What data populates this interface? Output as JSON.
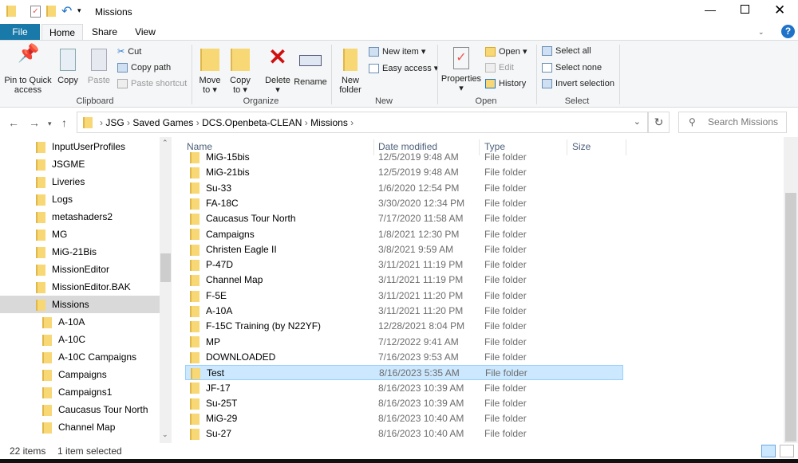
{
  "window": {
    "title": "Missions"
  },
  "tabs": [
    "File",
    "Home",
    "Share",
    "View"
  ],
  "ribbon": {
    "clipboard": {
      "label": "Clipboard",
      "pin": "Pin to Quick access",
      "copy": "Copy",
      "paste": "Paste",
      "cut": "Cut",
      "copy_path": "Copy path",
      "paste_shortcut": "Paste shortcut"
    },
    "organize": {
      "label": "Organize",
      "move_to": "Move to",
      "copy_to": "Copy to",
      "delete": "Delete",
      "rename": "Rename"
    },
    "new": {
      "label": "New",
      "new_folder": "New folder",
      "new_item": "New item",
      "easy_access": "Easy access"
    },
    "open": {
      "label": "Open",
      "properties": "Properties",
      "open": "Open",
      "edit": "Edit",
      "history": "History"
    },
    "select": {
      "label": "Select",
      "select_all": "Select all",
      "select_none": "Select none",
      "invert": "Invert selection"
    }
  },
  "address": {
    "crumbs": [
      "JSG",
      "Saved Games",
      "DCS.Openbeta-CLEAN",
      "Missions"
    ],
    "search_placeholder": "Search Missions"
  },
  "tree": [
    {
      "label": "InputUserProfiles",
      "level": 0
    },
    {
      "label": "JSGME",
      "level": 0
    },
    {
      "label": "Liveries",
      "level": 0
    },
    {
      "label": "Logs",
      "level": 0
    },
    {
      "label": "metashaders2",
      "level": 0
    },
    {
      "label": "MG",
      "level": 0
    },
    {
      "label": "MiG-21Bis",
      "level": 0
    },
    {
      "label": "MissionEditor",
      "level": 0
    },
    {
      "label": "MissionEditor.BAK",
      "level": 0
    },
    {
      "label": "Missions",
      "level": 0,
      "selected": true
    },
    {
      "label": "A-10A",
      "level": 1
    },
    {
      "label": "A-10C",
      "level": 1
    },
    {
      "label": "A-10C Campaigns",
      "level": 1
    },
    {
      "label": "Campaigns",
      "level": 1
    },
    {
      "label": "Campaigns1",
      "level": 1
    },
    {
      "label": "Caucasus Tour North",
      "level": 1
    },
    {
      "label": "Channel Map",
      "level": 1
    }
  ],
  "columns": [
    "Name",
    "Date modified",
    "Type",
    "Size"
  ],
  "files": [
    {
      "name": "MiG-15bis",
      "date": "12/5/2019 9:48 AM",
      "type": "File folder"
    },
    {
      "name": "MiG-21bis",
      "date": "12/5/2019 9:48 AM",
      "type": "File folder"
    },
    {
      "name": "Su-33",
      "date": "1/6/2020 12:54 PM",
      "type": "File folder"
    },
    {
      "name": "FA-18C",
      "date": "3/30/2020 12:34 PM",
      "type": "File folder"
    },
    {
      "name": "Caucasus Tour North",
      "date": "7/17/2020 11:58 AM",
      "type": "File folder"
    },
    {
      "name": "Campaigns",
      "date": "1/8/2021 12:30 PM",
      "type": "File folder"
    },
    {
      "name": "Christen Eagle II",
      "date": "3/8/2021 9:59 AM",
      "type": "File folder"
    },
    {
      "name": "P-47D",
      "date": "3/11/2021 11:19 PM",
      "type": "File folder"
    },
    {
      "name": "Channel Map",
      "date": "3/11/2021 11:19 PM",
      "type": "File folder"
    },
    {
      "name": "F-5E",
      "date": "3/11/2021 11:20 PM",
      "type": "File folder"
    },
    {
      "name": "A-10A",
      "date": "3/11/2021 11:20 PM",
      "type": "File folder"
    },
    {
      "name": "F-15C Training (by N22YF)",
      "date": "12/28/2021 8:04 PM",
      "type": "File folder"
    },
    {
      "name": "MP",
      "date": "7/12/2022 9:41 AM",
      "type": "File folder"
    },
    {
      "name": "DOWNLOADED",
      "date": "7/16/2023 9:53 AM",
      "type": "File folder"
    },
    {
      "name": "Test",
      "date": "8/16/2023 5:35 AM",
      "type": "File folder",
      "selected": true
    },
    {
      "name": "JF-17",
      "date": "8/16/2023 10:39 AM",
      "type": "File folder"
    },
    {
      "name": "Su-25T",
      "date": "8/16/2023 10:39 AM",
      "type": "File folder"
    },
    {
      "name": "MiG-29",
      "date": "8/16/2023 10:40 AM",
      "type": "File folder"
    },
    {
      "name": "Su-27",
      "date": "8/16/2023 10:40 AM",
      "type": "File folder"
    }
  ],
  "status": {
    "count": "22 items",
    "selected": "1 item selected"
  },
  "colors": {
    "file_tab": "#1979a9",
    "selection": "#cce8ff",
    "folder": "#f8d775"
  }
}
